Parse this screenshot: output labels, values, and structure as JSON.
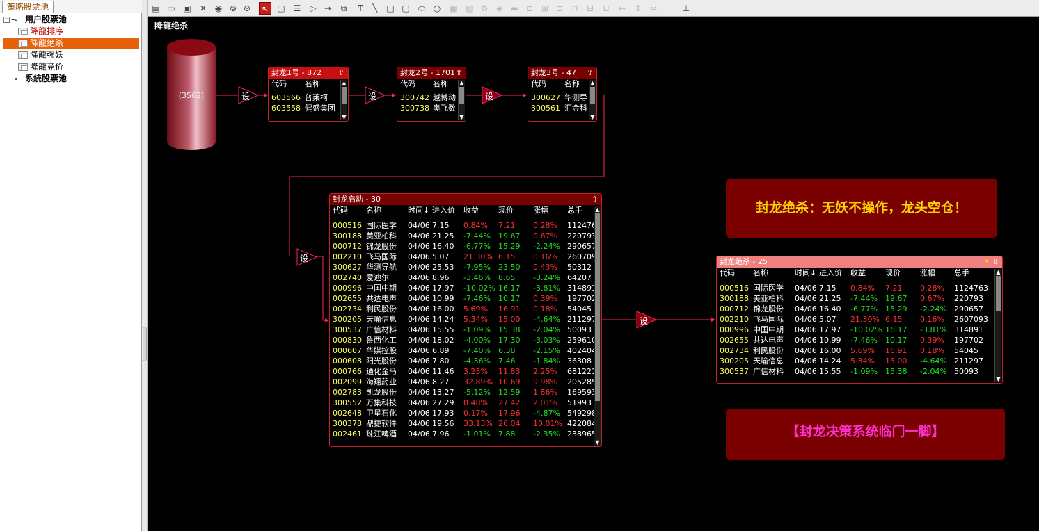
{
  "left_panel": {
    "tab": "策略股票池",
    "tree": [
      {
        "label": "用户股票池",
        "level": 0,
        "bold": true,
        "expander": "−"
      },
      {
        "label": "降龍排序",
        "level": 1,
        "color": "#c00000"
      },
      {
        "label": "降龍绝杀",
        "level": 1,
        "selected": true
      },
      {
        "label": "降龍强妖",
        "level": 1
      },
      {
        "label": "降龍竞价",
        "level": 1
      },
      {
        "label": "系統股票池",
        "level": 0,
        "bold": true
      }
    ]
  },
  "toolbar": {
    "icons": [
      "new-doc-icon",
      "open-icon",
      "save-icon",
      "delete-icon",
      "run-icon",
      "pause-icon",
      "stop-icon",
      "pointer-icon",
      "rounded-rect-icon",
      "list-icon",
      "triangle-icon",
      "arrow-icon",
      "copy-icon",
      "text-icon",
      "line-icon",
      "rect-icon",
      "round-rect-icon",
      "ellipse-icon",
      "circle-icon",
      "group-icon",
      "ungroup-icon",
      "recycle-icon",
      "fill-icon",
      "pen-icon",
      "align-left-icon",
      "align-center-icon",
      "align-right-icon",
      "align-top-icon",
      "align-middle-icon",
      "align-bottom-icon",
      "same-width-icon",
      "same-height-icon",
      "same-size-icon",
      "grid-icon"
    ]
  },
  "canvas": {
    "title": "降龍绝杀",
    "source": {
      "label": "(3562)"
    },
    "setter_label": "设",
    "panel1": {
      "title": "封龙1号 - 872",
      "headers": [
        "代码",
        "名称"
      ],
      "rows": [
        [
          "603566",
          "普莱柯"
        ],
        [
          "603558",
          "健盛集团"
        ]
      ]
    },
    "panel2": {
      "title": "封龙2号 - 1701",
      "headers": [
        "代码",
        "名称"
      ],
      "rows": [
        [
          "300742",
          "越博动"
        ],
        [
          "300738",
          "奥飞数"
        ]
      ]
    },
    "panel3": {
      "title": "封龙3号 - 47",
      "headers": [
        "代码",
        "名称"
      ],
      "rows": [
        [
          "300627",
          "华测导"
        ],
        [
          "300561",
          "汇金科"
        ]
      ]
    },
    "panel_start": {
      "title": "封龙启动 - 30",
      "headers": [
        "代码",
        "名称",
        "时间↓",
        "进入价",
        "收益",
        "现价",
        "涨幅",
        "总手"
      ],
      "rows": [
        [
          "000516",
          "国际医学",
          "04/06",
          "7.15",
          "0.84%",
          "7.21",
          "0.28%",
          "112476"
        ],
        [
          "300188",
          "美亚柏科",
          "04/06",
          "21.25",
          "-7.44%",
          "19.67",
          "0.67%",
          "220793"
        ],
        [
          "000712",
          "锦龙股份",
          "04/06",
          "16.40",
          "-6.77%",
          "15.29",
          "-2.24%",
          "290657"
        ],
        [
          "002210",
          "飞马国际",
          "04/06",
          "5.07",
          "21.30%",
          "6.15",
          "0.16%",
          "260709"
        ],
        [
          "300627",
          "华测导航",
          "04/06",
          "25.53",
          "-7.95%",
          "23.50",
          "0.43%",
          "50312"
        ],
        [
          "002740",
          "爱迪尔",
          "04/06",
          "8.96",
          "-3.46%",
          "8.65",
          "-3.24%",
          "64207"
        ],
        [
          "000996",
          "中国中期",
          "04/06",
          "17.97",
          "-10.02%",
          "16.17",
          "-3.81%",
          "314891"
        ],
        [
          "002655",
          "共达电声",
          "04/06",
          "10.99",
          "-7.46%",
          "10.17",
          "0.39%",
          "197702"
        ],
        [
          "002734",
          "利民股份",
          "04/06",
          "16.00",
          "5.69%",
          "16.91",
          "0.18%",
          "54045"
        ],
        [
          "300205",
          "天喻信息",
          "04/06",
          "14.24",
          "5.34%",
          "15.00",
          "-4.64%",
          "211297"
        ],
        [
          "300537",
          "广信材料",
          "04/06",
          "15.55",
          "-1.09%",
          "15.38",
          "-2.04%",
          "50093"
        ],
        [
          "000830",
          "鲁西化工",
          "04/06",
          "18.02",
          "-4.00%",
          "17.30",
          "-3.03%",
          "259610"
        ],
        [
          "000607",
          "华媒控股",
          "04/06",
          "6.89",
          "-7.40%",
          "6.38",
          "-2.15%",
          "402404"
        ],
        [
          "000608",
          "阳光股份",
          "04/06",
          "7.80",
          "-4.36%",
          "7.46",
          "-1.84%",
          "36308"
        ],
        [
          "000766",
          "通化金马",
          "04/06",
          "11.46",
          "3.23%",
          "11.83",
          "2.25%",
          "681221"
        ],
        [
          "002099",
          "海翔药业",
          "04/06",
          "8.27",
          "32.89%",
          "10.69",
          "9.98%",
          "205285"
        ],
        [
          "002783",
          "凯龙股份",
          "04/06",
          "13.27",
          "-5.12%",
          "12.59",
          "1.86%",
          "169593"
        ],
        [
          "300552",
          "万集科技",
          "04/06",
          "27.29",
          "0.48%",
          "27.42",
          "2.01%",
          "51993"
        ],
        [
          "002648",
          "卫星石化",
          "04/06",
          "17.93",
          "0.17%",
          "17.96",
          "-4.87%",
          "549298"
        ],
        [
          "300378",
          "鼎捷软件",
          "04/06",
          "19.56",
          "33.13%",
          "26.04",
          "10.01%",
          "422084"
        ],
        [
          "002461",
          "珠江啤酒",
          "04/06",
          "7.96",
          "-1.01%",
          "7.88",
          "-2.35%",
          "238965"
        ]
      ]
    },
    "panel_kill": {
      "title": "封龙绝杀 - 25",
      "headers": [
        "代码",
        "名称",
        "时间↓",
        "进入价",
        "收益",
        "现价",
        "涨幅",
        "总手"
      ],
      "rows": [
        [
          "000516",
          "国际医学",
          "04/06",
          "7.15",
          "0.84%",
          "7.21",
          "0.28%",
          "1124763"
        ],
        [
          "300188",
          "美亚柏科",
          "04/06",
          "21.25",
          "-7.44%",
          "19.67",
          "0.67%",
          "220793"
        ],
        [
          "000712",
          "锦龙股份",
          "04/06",
          "16.40",
          "-6.77%",
          "15.29",
          "-2.24%",
          "290657"
        ],
        [
          "002210",
          "飞马国际",
          "04/06",
          "5.07",
          "21.30%",
          "6.15",
          "0.16%",
          "2607093"
        ],
        [
          "000996",
          "中国中期",
          "04/06",
          "17.97",
          "-10.02%",
          "16.17",
          "-3.81%",
          "314891"
        ],
        [
          "002655",
          "共达电声",
          "04/06",
          "10.99",
          "-7.46%",
          "10.17",
          "0.39%",
          "197702"
        ],
        [
          "002734",
          "利民股份",
          "04/06",
          "16.00",
          "5.69%",
          "16.91",
          "0.18%",
          "54045"
        ],
        [
          "300205",
          "天喻信息",
          "04/06",
          "14.24",
          "5.34%",
          "15.00",
          "-4.64%",
          "211297"
        ],
        [
          "300537",
          "广信材料",
          "04/06",
          "15.55",
          "-1.09%",
          "15.38",
          "-2.04%",
          "50093"
        ]
      ]
    },
    "banner1": "封龙绝杀：无妖不操作，龙头空仓！",
    "banner2": "【封龙决策系统临门一脚】",
    "colors": {
      "banner1_text": "#ffd200",
      "banner2_text": "#ff30d0",
      "up": "#ff3030",
      "down": "#20e020",
      "code": "#ffff60"
    }
  }
}
